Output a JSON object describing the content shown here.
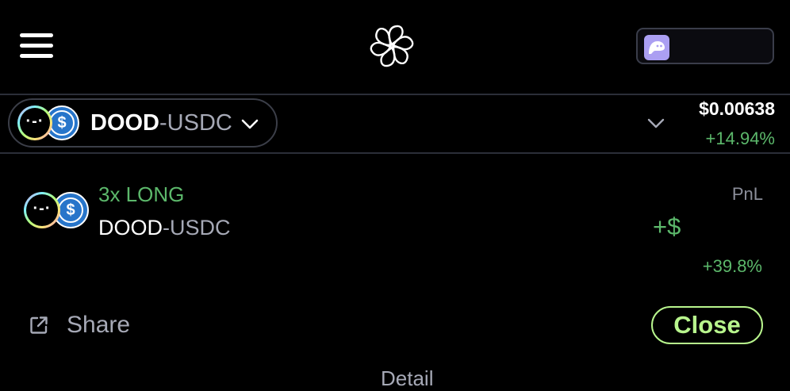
{
  "header": {
    "menu_icon": "hamburger-menu-icon",
    "logo_icon": "flower-logo-icon",
    "wallet_icon": "phantom-ghost-icon",
    "wallet_label": ""
  },
  "pair_selector": {
    "base": "DOOD",
    "separator": "-",
    "quote": "USDC",
    "base_icon": "dood-token-icon",
    "quote_icon": "usdc-token-icon"
  },
  "market": {
    "price": "$0.00638",
    "change": "+14.94%"
  },
  "position": {
    "leverage": "3x LONG",
    "base": "DOOD",
    "separator": "-",
    "quote": "USDC",
    "pnl_label": "PnL",
    "pnl_value": "+$",
    "pnl_percent": "+39.8%"
  },
  "actions": {
    "share_label": "Share",
    "share_icon": "external-link-icon",
    "close_label": "Close"
  },
  "footer": {
    "details_label": "Detail"
  },
  "colors": {
    "background": "#000000",
    "positive": "#5cb86b",
    "close_accent": "#b8f58d",
    "muted": "#a6a9b6",
    "divider": "#2b2e38",
    "wallet_accent": "#ab9ff2"
  }
}
